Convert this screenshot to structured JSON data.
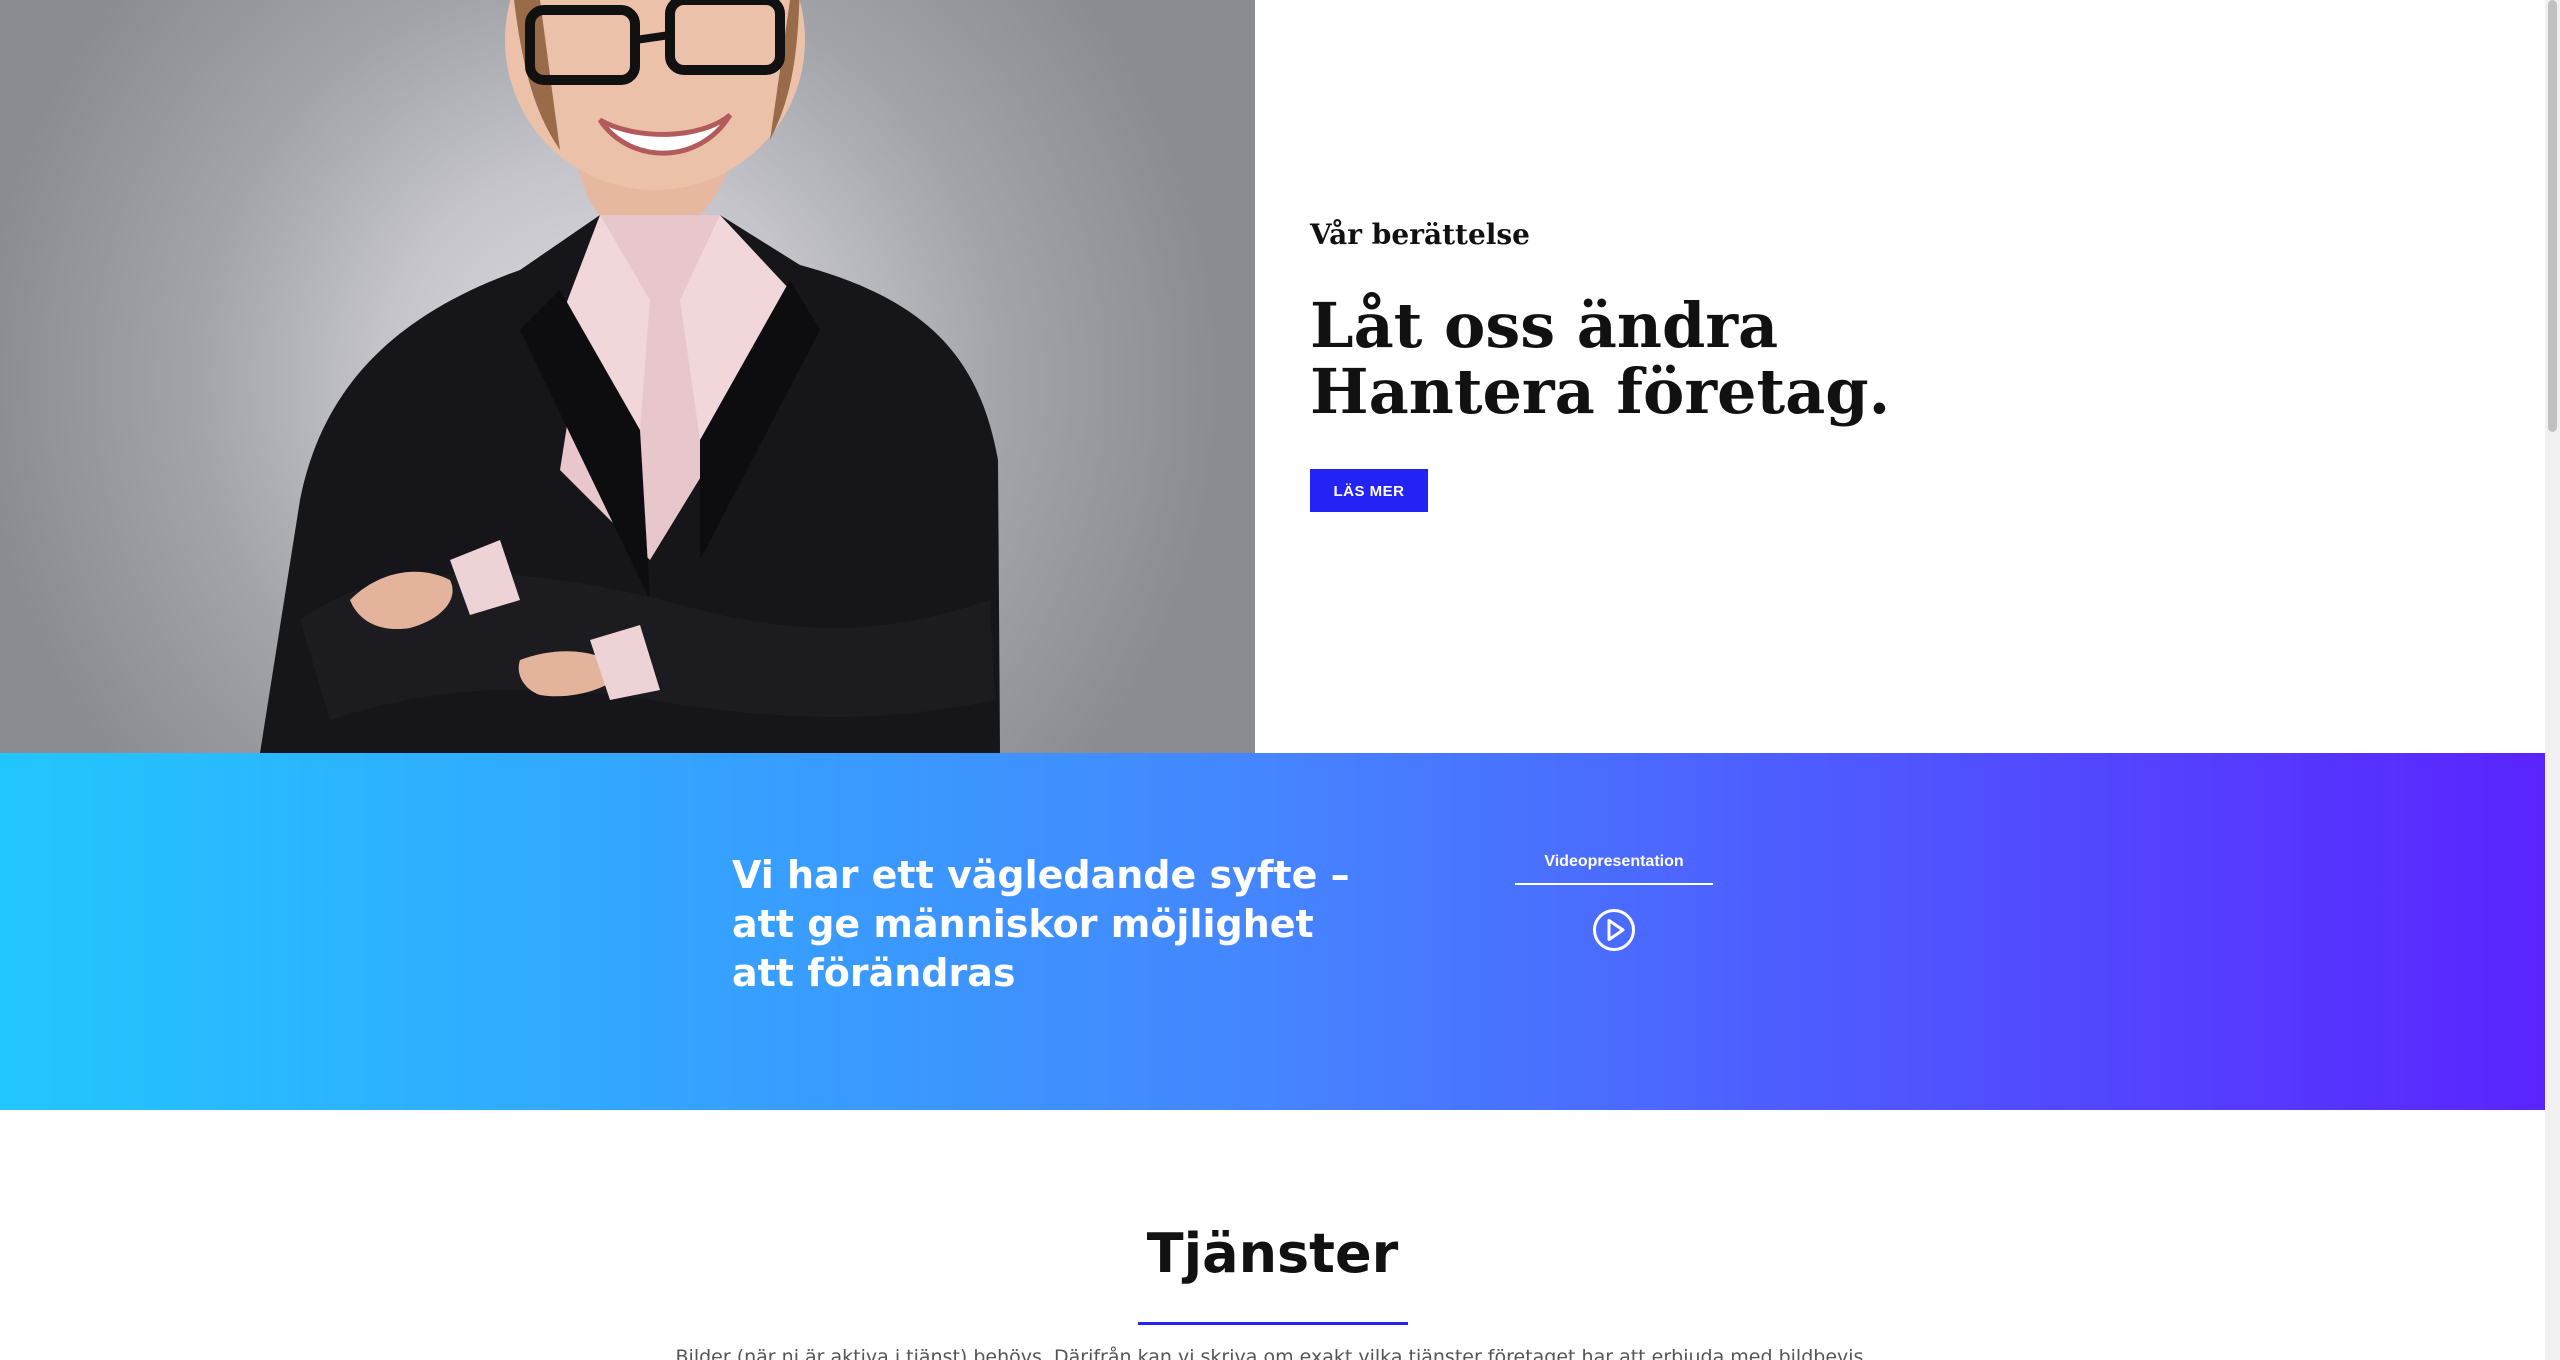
{
  "hero": {
    "eyebrow": "Vår berättelse",
    "headline": "Låt oss ändra Hantera företag.",
    "cta_label": "LÄS MER"
  },
  "band": {
    "text": "Vi har ett vägledande syfte – att ge människor möjlighet att förändras",
    "video_tab_label": "Videopresentation",
    "play_icon": "play-circle-icon"
  },
  "services": {
    "title": "Tjänster",
    "intro": "Bilder (när ni är aktiva i tjänst) behövs. Därifrån kan vi skriva om exakt vilka tjänster företaget har att erbjuda med bildbevis."
  },
  "colors": {
    "accent": "#2323f5",
    "gradient_start": "#22c6ff",
    "gradient_end": "#5a24ff"
  }
}
